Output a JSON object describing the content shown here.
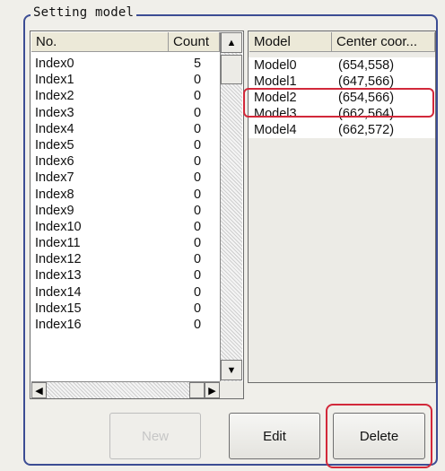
{
  "group_title": "Setting model",
  "left_list": {
    "headers": [
      "No.",
      "Count"
    ],
    "rows": [
      {
        "no": "Index0",
        "count": "5"
      },
      {
        "no": "Index1",
        "count": "0"
      },
      {
        "no": "Index2",
        "count": "0"
      },
      {
        "no": "Index3",
        "count": "0"
      },
      {
        "no": "Index4",
        "count": "0"
      },
      {
        "no": "Index5",
        "count": "0"
      },
      {
        "no": "Index6",
        "count": "0"
      },
      {
        "no": "Index7",
        "count": "0"
      },
      {
        "no": "Index8",
        "count": "0"
      },
      {
        "no": "Index9",
        "count": "0"
      },
      {
        "no": "Index10",
        "count": "0"
      },
      {
        "no": "Index11",
        "count": "0"
      },
      {
        "no": "Index12",
        "count": "0"
      },
      {
        "no": "Index13",
        "count": "0"
      },
      {
        "no": "Index14",
        "count": "0"
      },
      {
        "no": "Index15",
        "count": "0"
      },
      {
        "no": "Index16",
        "count": "0"
      }
    ]
  },
  "right_list": {
    "headers": [
      "Model",
      "Center coor..."
    ],
    "rows": [
      {
        "model": "Model0",
        "center": "(654,558)"
      },
      {
        "model": "Model1",
        "center": "(647,566)"
      },
      {
        "model": "Model2",
        "center": "(654,566)"
      },
      {
        "model": "Model3",
        "center": "(662,564)"
      },
      {
        "model": "Model4",
        "center": "(662,572)"
      }
    ],
    "highlighted_row": "Model2"
  },
  "buttons": {
    "new": "New",
    "edit": "Edit",
    "delete": "Delete"
  },
  "colors": {
    "frame": "#3c4d94",
    "highlight": "#d2283a"
  }
}
